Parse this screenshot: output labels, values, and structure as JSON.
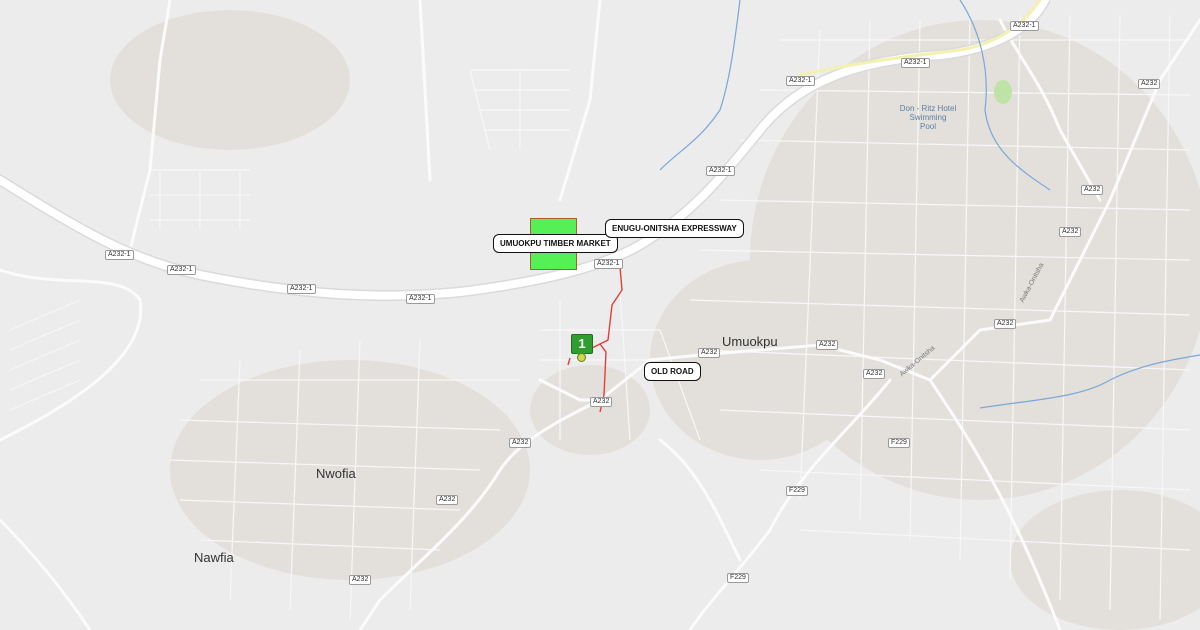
{
  "map": {
    "colors": {
      "background": "#ececec",
      "road": "#ffffff",
      "expressway": "#ffffff",
      "expressway_casing": "#dcdcdc",
      "route": "#e0403a",
      "water": "#7aa7d9",
      "park": "#bfe3a6",
      "market_area": "#55f055",
      "marker": "#2f9e2f"
    },
    "towns": {
      "umuokpu": "Umuokpu",
      "nwofia": "Nwofia",
      "nawfia": "Nawfia"
    },
    "road_shields": {
      "a2321_top_right": "A232-1",
      "a2321_upper": "A232-1",
      "a2321_mid": "A232-1",
      "a2321_west": "A232-1",
      "a2321_west2": "A232-1",
      "a2321_centre": "A232-1",
      "a2321_centre2": "A232-1",
      "a2321_market": "A232-1",
      "a232_ne": "A232",
      "a232_east1": "A232",
      "a232_east2": "A232",
      "a232_east3": "A232",
      "a232_umuokpu": "A232",
      "a232_umuokpu2": "A232",
      "a232_south1": "A232",
      "a232_south2": "A232",
      "a232_sw1": "A232",
      "a232_sw2": "A232",
      "a232_mid": "A232",
      "f229_1": "F229",
      "f229_2": "F229",
      "f229_3": "F229"
    },
    "poi": {
      "line1": "Don - Ritz Hotel",
      "line2": "Swimming",
      "line3": "Pool"
    },
    "road_names": {
      "awka_onitsha_1": "Awka-Onitsha",
      "awka_onitsha_2": "Awka-Onitsha"
    },
    "callouts": {
      "market": "UMUOKPU TIMBER MARKET",
      "expressway": "ENUGU-ONITSHA EXPRESSWAY",
      "old_road": "OLD ROAD"
    },
    "marker": {
      "number": "1"
    }
  }
}
